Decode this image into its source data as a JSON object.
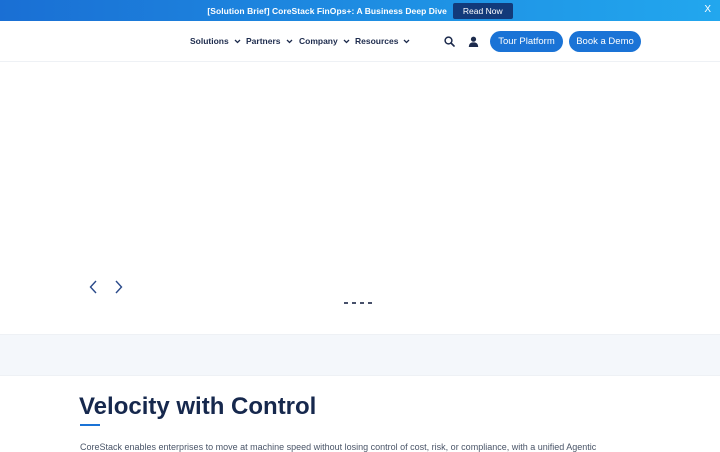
{
  "announcement": {
    "text": "[Solution Brief] CoreStack FinOps+: A Business Deep Dive",
    "button_label": "Read Now",
    "close_label": "X"
  },
  "nav": {
    "items": [
      {
        "label": "Solutions"
      },
      {
        "label": "Partners"
      },
      {
        "label": "Company"
      },
      {
        "label": "Resources"
      }
    ],
    "search_icon": "search-icon",
    "user_icon": "user-icon",
    "tour_button": "Tour Platform",
    "demo_button": "Book a Demo"
  },
  "carousel": {
    "prev_icon": "chevron-left-icon",
    "next_icon": "chevron-right-icon",
    "slide_count": 4
  },
  "section": {
    "title": "Velocity with Control",
    "body": "CoreStack enables enterprises to move at machine speed without losing control of cost, risk, or compliance, with a unified Agentic"
  },
  "colors": {
    "primary": "#1a73d6",
    "navy": "#16284d",
    "announce_button": "#123a7a"
  }
}
